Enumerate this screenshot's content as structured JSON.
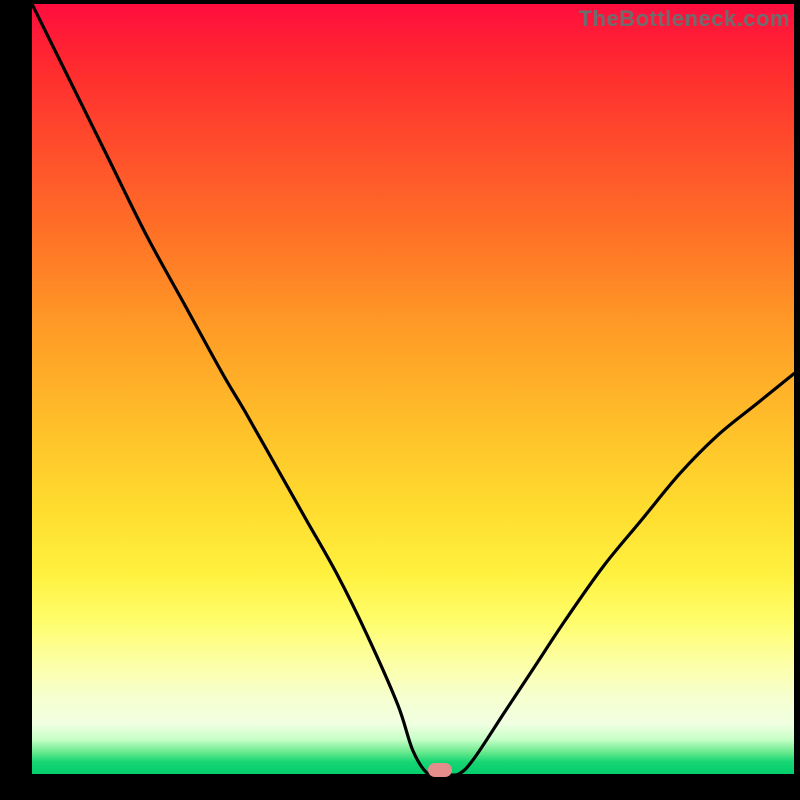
{
  "watermark": "TheBottleneck.com",
  "valley": {
    "x_pct": 53.5,
    "y_pct": 99.5
  },
  "chart_data": {
    "type": "line",
    "title": "",
    "xlabel": "",
    "ylabel": "",
    "xlim": [
      0,
      100
    ],
    "ylim": [
      0,
      100
    ],
    "series": [
      {
        "name": "bottleneck-curve",
        "x": [
          0,
          5,
          10,
          15,
          20,
          25,
          28,
          32,
          36,
          40,
          44,
          48,
          50,
          52,
          54,
          56,
          58,
          62,
          66,
          70,
          75,
          80,
          85,
          90,
          95,
          100
        ],
        "y": [
          100,
          90,
          80,
          70,
          61,
          52,
          47,
          40,
          33,
          26,
          18,
          9,
          3,
          0,
          0,
          0,
          2,
          8,
          14,
          20,
          27,
          33,
          39,
          44,
          48,
          52
        ]
      }
    ],
    "annotations": [
      {
        "text": "TheBottleneck.com",
        "position": "top-right"
      }
    ],
    "background_gradient": {
      "top": "#ff0d3e",
      "mid": "#ffe23a",
      "bottom": "#04ce6d"
    },
    "marker": {
      "x": 53.5,
      "y": 0,
      "color": "#e58c8c",
      "shape": "pill"
    }
  }
}
